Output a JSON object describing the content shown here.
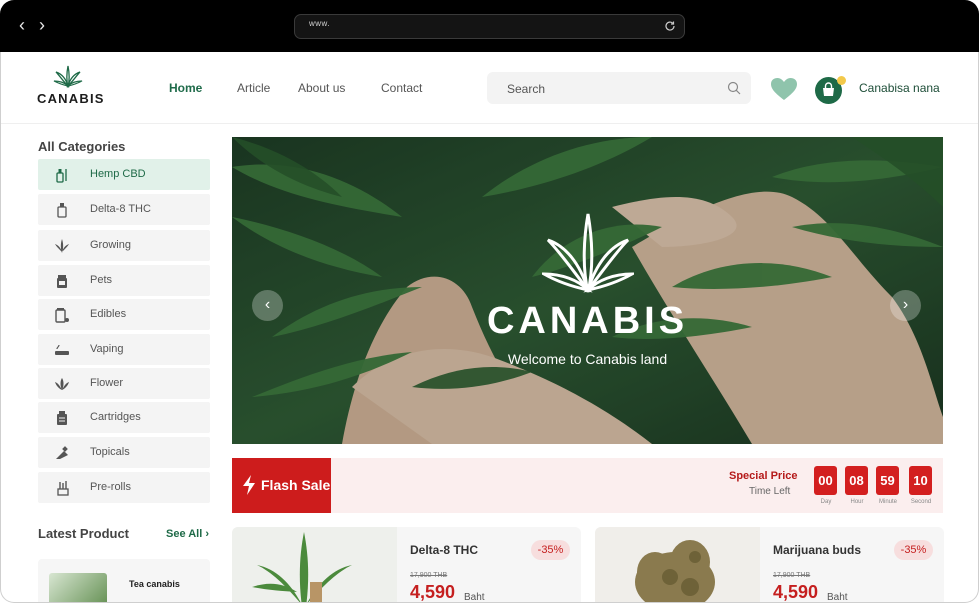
{
  "browser": {
    "url": "www.",
    "back": "‹",
    "forward": "›"
  },
  "header": {
    "logo_text": "CANABIS",
    "nav": [
      "Home",
      "Article",
      "About us",
      "Contact"
    ],
    "search_placeholder": "Search",
    "user_name": "Canabisa nana"
  },
  "sidebar": {
    "title": "All Categories",
    "categories": [
      {
        "label": "Hemp CBD",
        "icon": "bottle-icon"
      },
      {
        "label": "Delta-8 THC",
        "icon": "vial-icon"
      },
      {
        "label": "Growing",
        "icon": "leaf-icon"
      },
      {
        "label": "Pets",
        "icon": "jar-icon"
      },
      {
        "label": "Edibles",
        "icon": "pill-jar-icon"
      },
      {
        "label": "Vaping",
        "icon": "vape-icon"
      },
      {
        "label": "Flower",
        "icon": "flower-icon"
      },
      {
        "label": "Cartridges",
        "icon": "cartridge-icon"
      },
      {
        "label": "Topicals",
        "icon": "tube-icon"
      },
      {
        "label": "Pre-rolls",
        "icon": "pre-roll-icon"
      }
    ],
    "latest_title": "Latest Product",
    "see_all": "See All",
    "latest_item": "Tea canabis"
  },
  "hero": {
    "title": "CANABIS",
    "subtitle": "Welcome to Canabis land"
  },
  "flash_sale": {
    "label": "Flash Sale",
    "special_price": "Special Price",
    "time_left": "Time Left",
    "countdown": [
      {
        "value": "00",
        "unit": "Day"
      },
      {
        "value": "08",
        "unit": "Hour"
      },
      {
        "value": "59",
        "unit": "Minute"
      },
      {
        "value": "10",
        "unit": "Second"
      }
    ]
  },
  "products": [
    {
      "name": "Delta-8 THC",
      "discount": "-35%",
      "old_price": "17,900 THB",
      "price": "4,590",
      "currency": "Baht"
    },
    {
      "name": "Marijuana buds",
      "discount": "-35%",
      "old_price": "17,900 THB",
      "price": "4,590",
      "currency": "Baht"
    }
  ],
  "colors": {
    "brand_green": "#1e6a47",
    "sale_red": "#cd1c1c",
    "active_bg": "#e1f1e9"
  }
}
